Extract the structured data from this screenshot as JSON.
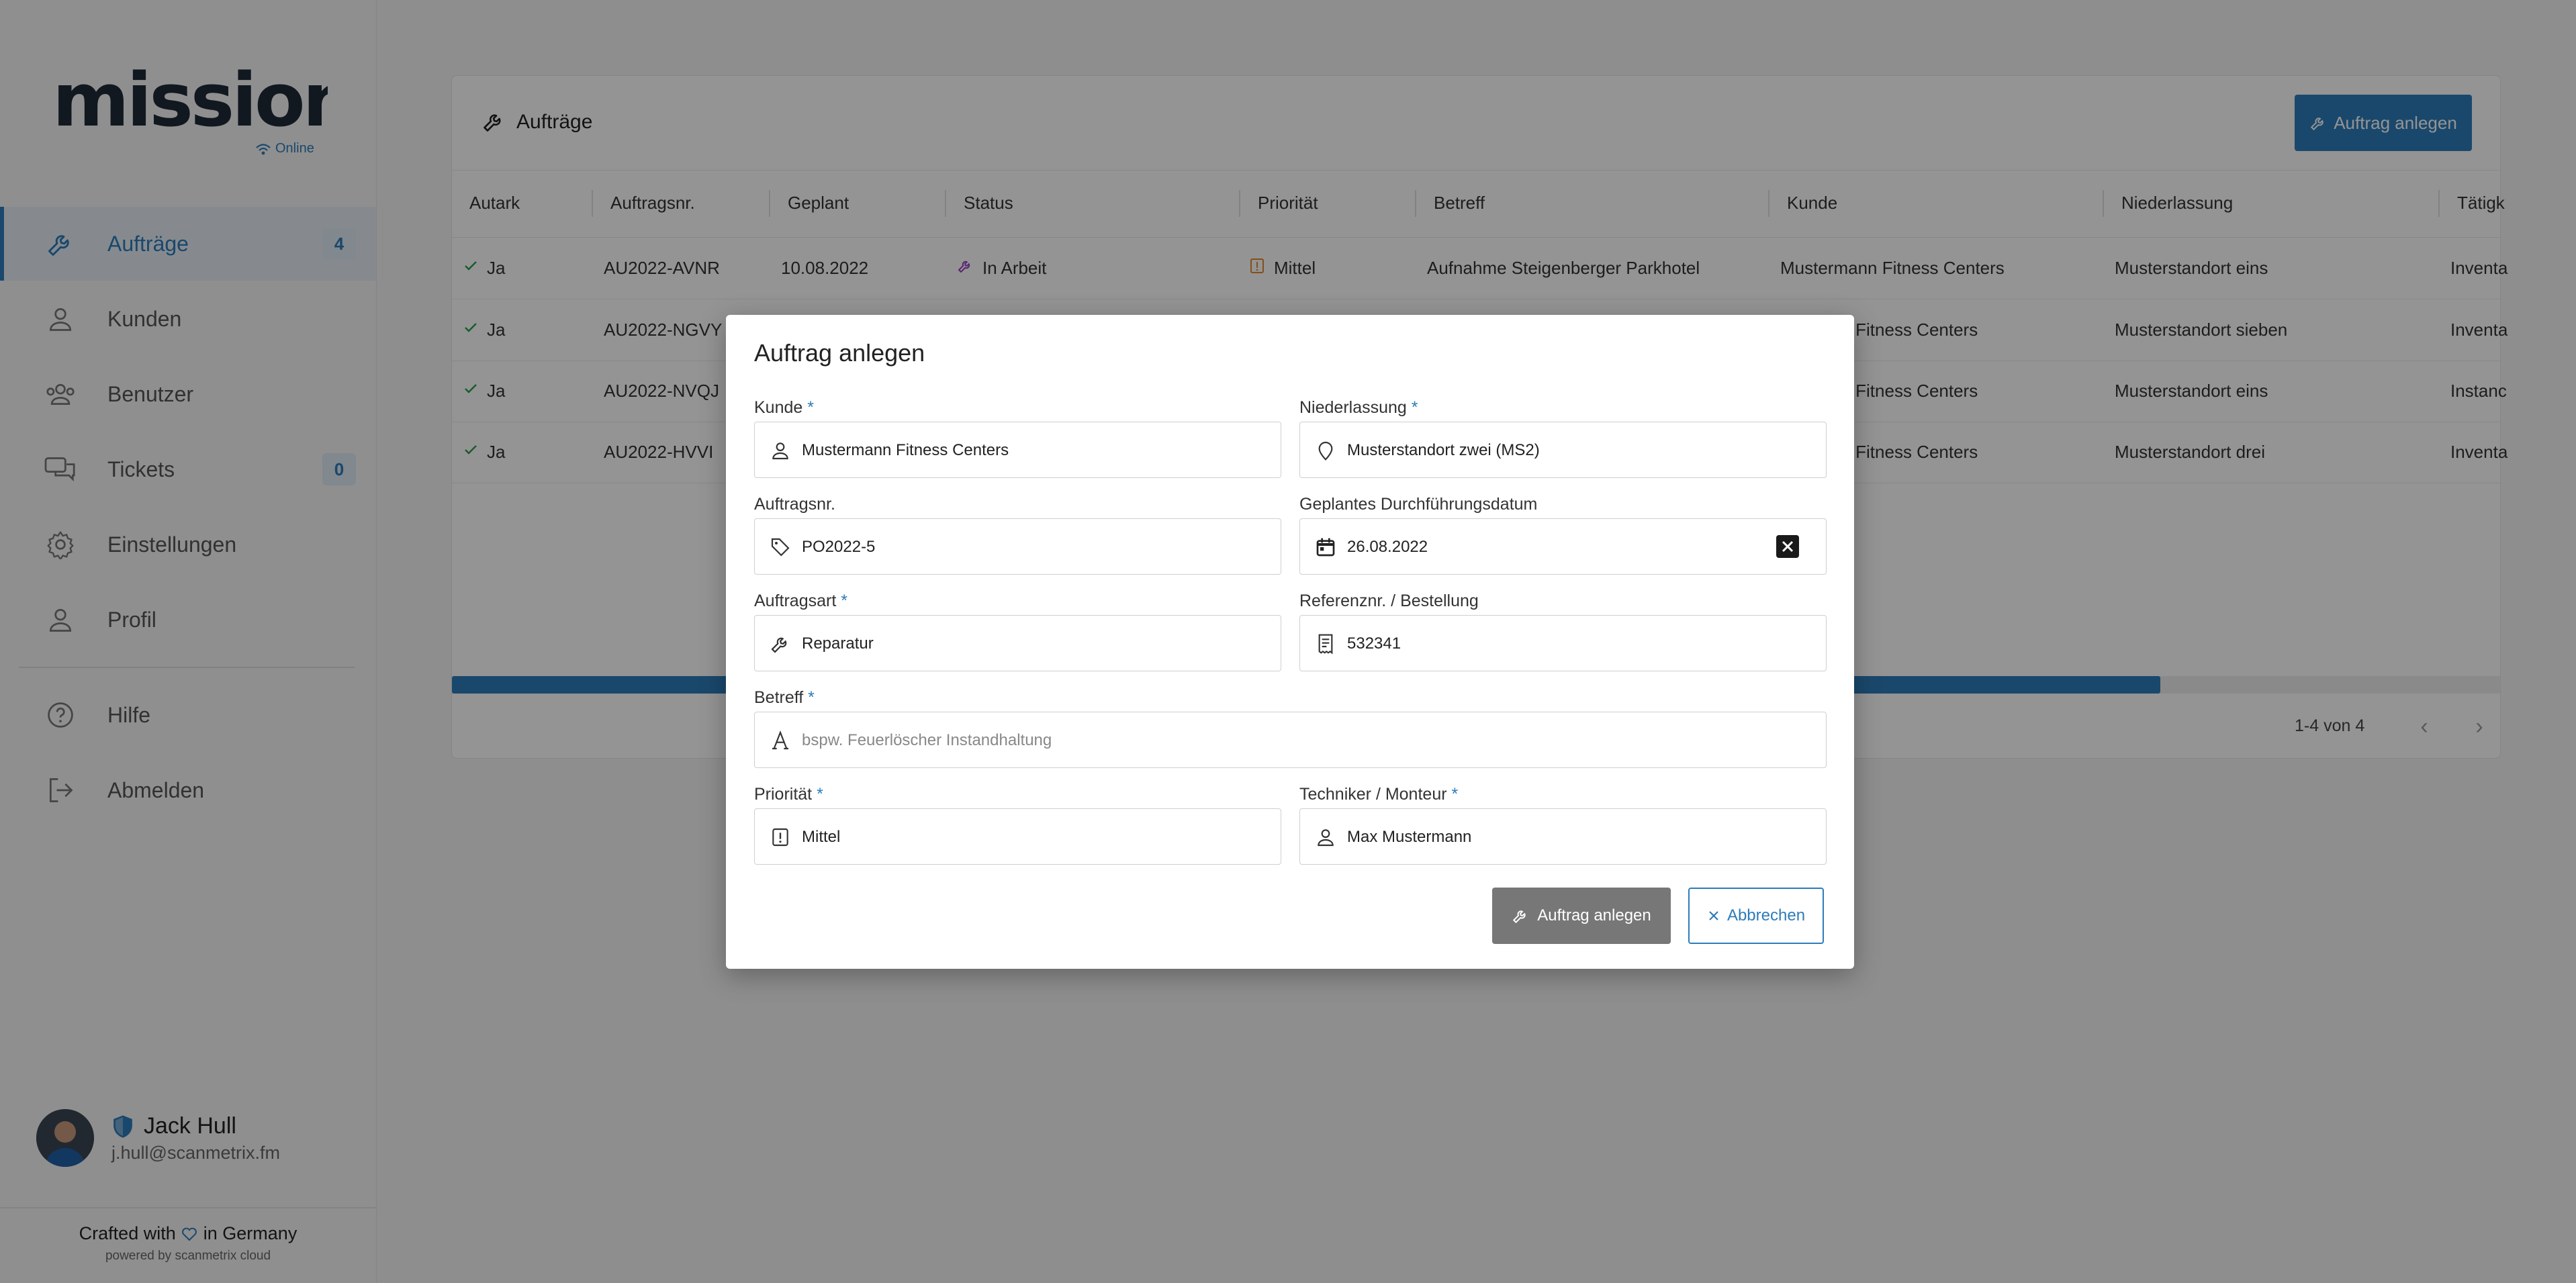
{
  "app": {
    "logo_text": "mission",
    "online_label": "Online",
    "accent_color": "#2d7cba"
  },
  "sidebar": {
    "items": [
      {
        "label": "Aufträge",
        "icon": "wrench-icon",
        "badge": "4",
        "active": true
      },
      {
        "label": "Kunden",
        "icon": "person-icon"
      },
      {
        "label": "Benutzer",
        "icon": "users-icon"
      },
      {
        "label": "Tickets",
        "icon": "chat-icon",
        "badge": "0"
      },
      {
        "label": "Einstellungen",
        "icon": "gear-icon"
      },
      {
        "label": "Profil",
        "icon": "person-icon"
      },
      {
        "label": "Hilfe",
        "icon": "help-icon"
      },
      {
        "label": "Abmelden",
        "icon": "logout-icon"
      }
    ],
    "user": {
      "name": "Jack Hull",
      "email": "j.hull@scanmetrix.fm"
    },
    "footer": {
      "crafted_prefix": "Crafted with",
      "crafted_suffix": "in Germany",
      "powered": "powered by scanmetrix cloud"
    }
  },
  "page": {
    "title": "Aufträge",
    "create_button": "Auftrag anlegen",
    "columns": [
      "Autark",
      "Auftragsnr.",
      "Geplant",
      "Status",
      "Priorität",
      "Betreff",
      "Kunde",
      "Niederlassung",
      "Tätigk"
    ],
    "rows": [
      {
        "autark": "Ja",
        "nr": "AU2022-AVNR",
        "geplant": "10.08.2022",
        "status": "In Arbeit",
        "prio": "Mittel",
        "betreff": "Aufnahme Steigenberger Parkhotel",
        "kunde": "Mustermann Fitness Centers",
        "niederlassung": "Musterstandort eins",
        "taetigkeit": "Inventa"
      },
      {
        "autark": "Ja",
        "nr": "AU2022-NGVY",
        "geplant": "",
        "status": "",
        "prio": "",
        "betreff": "",
        "kunde": "nn Fitness Centers",
        "niederlassung": "Musterstandort sieben",
        "taetigkeit": "Inventa"
      },
      {
        "autark": "Ja",
        "nr": "AU2022-NVQJ",
        "geplant": "",
        "status": "",
        "prio": "",
        "betreff": "",
        "kunde": "nn Fitness Centers",
        "niederlassung": "Musterstandort eins",
        "taetigkeit": "Instanc"
      },
      {
        "autark": "Ja",
        "nr": "AU2022-HVVI",
        "geplant": "",
        "status": "",
        "prio": "",
        "betreff": "",
        "kunde": "nn Fitness Centers",
        "niederlassung": "Musterstandort drei",
        "taetigkeit": "Inventa"
      }
    ],
    "pager_text": "1-4 von 4",
    "scroll_fraction": 0.834
  },
  "modal": {
    "title": "Auftrag anlegen",
    "fields": {
      "kunde": {
        "label": "Kunde",
        "required": "*",
        "value": "Mustermann Fitness Centers",
        "icon": "person-icon"
      },
      "niederlassung": {
        "label": "Niederlassung",
        "required": "*",
        "value": "Musterstandort zwei (MS2)",
        "icon": "location-pin-icon"
      },
      "auftragsnr": {
        "label": "Auftragsnr.",
        "value": "PO2022-5",
        "icon": "tag-icon"
      },
      "datum": {
        "label": "Geplantes Durchführungsdatum",
        "value": "26.08.2022",
        "icon": "calendar-icon"
      },
      "auftragsart": {
        "label": "Auftragsart",
        "required": "*",
        "value": "Reparatur",
        "icon": "wrench-icon"
      },
      "referenz": {
        "label": "Referenznr. / Bestellung",
        "value": "532341",
        "icon": "receipt-icon"
      },
      "betreff": {
        "label": "Betreff",
        "required": "*",
        "placeholder": "bspw. Feuerlöscher Instandhaltung",
        "icon": "text-icon"
      },
      "prioritaet": {
        "label": "Priorität",
        "required": "*",
        "value": "Mittel",
        "icon": "priority-icon"
      },
      "techniker": {
        "label": "Techniker / Monteur",
        "required": "*",
        "value": "Max Mustermann",
        "icon": "person-icon"
      }
    },
    "create_button": "Auftrag anlegen",
    "cancel_button": "Abbrechen"
  }
}
